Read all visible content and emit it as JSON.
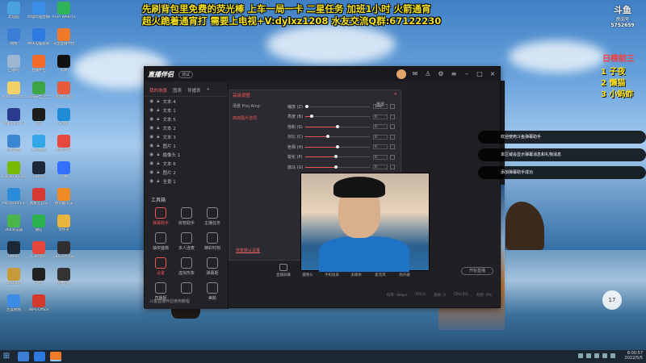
{
  "overlay": {
    "line1": "先刷背包里免费的荧光棒    上车一局一卡      二星任务 加班1小时    火箭通宵",
    "line2": "超火跪着通宵打  需要上电视+V:dylxz1208   水友交流Q群:67122230"
  },
  "desktop_icons": [
    {
      "label": "此电脑",
      "color": "#4aa3df"
    },
    {
      "label": "哔哩哔哩直播姬",
      "color": "#3a8ee6"
    },
    {
      "label": "Iriun Webcam",
      "color": "#2fb45a"
    },
    {
      "label": "网络",
      "color": "#3a7fd5"
    },
    {
      "label": "腾讯电脑管家",
      "color": "#2d7be0"
    },
    {
      "label": "斗鱼直播伴侣",
      "color": "#f07a2a"
    },
    {
      "label": "回收站",
      "color": "#9cb7d2"
    },
    {
      "label": "直播伴侣",
      "color": "#f26b2a"
    },
    {
      "label": "剪映",
      "color": "#111"
    },
    {
      "label": "Administrator",
      "color": "#f3d166"
    },
    {
      "label": "360安全卫士",
      "color": "#3ea544"
    },
    {
      "label": "游戏加速器",
      "color": "#e85a3c"
    },
    {
      "label": "Wallpaper Engine",
      "color": "#2a3a8f"
    },
    {
      "label": "QQ",
      "color": "#1d1d1d"
    },
    {
      "label": "Edge",
      "color": "#1f8ad6"
    },
    {
      "label": "控制面板",
      "color": "#3b86d1"
    },
    {
      "label": "腾讯视频",
      "color": "#33a6ea"
    },
    {
      "label": "酷狗音乐",
      "color": "#e8473b"
    },
    {
      "label": "GeForce Experience",
      "color": "#76b900"
    },
    {
      "label": "Steam",
      "color": "#1b2838"
    },
    {
      "label": "飞书",
      "color": "#3370ff"
    },
    {
      "label": "Microsoft Edge",
      "color": "#2b8bd8"
    },
    {
      "label": "网易云音乐",
      "color": "#d63a32"
    },
    {
      "label": "搜狗输入法",
      "color": "#f08a24"
    },
    {
      "label": "360浏览器",
      "color": "#49b54b"
    },
    {
      "label": "微信",
      "color": "#2bb24c"
    },
    {
      "label": "文件夹",
      "color": "#e8b63c"
    },
    {
      "label": "Steam",
      "color": "#1b2838"
    },
    {
      "label": "Chrome",
      "color": "#e4463a"
    },
    {
      "label": "OBS Studio",
      "color": "#302e31"
    },
    {
      "label": "WeGame",
      "color": "#c79a3a"
    },
    {
      "label": "斗鱼",
      "color": "#222"
    },
    {
      "label": "快捷方式",
      "color": "#333"
    },
    {
      "label": "百度网盘",
      "color": "#3c8ce6"
    },
    {
      "label": "WPS Office",
      "color": "#d33a2c"
    }
  ],
  "app": {
    "title": "直播伴侣",
    "version": "测试",
    "tabs": [
      "我的场景",
      "图表",
      "导播表",
      "+"
    ],
    "sources": [
      "文本 4",
      "文本 1",
      "文本 5",
      "文本 2",
      "文本 3",
      "图片 1",
      "摄像头 1",
      "文本 6",
      "图片 2",
      "全景 1"
    ],
    "toolbox_title": "工具箱",
    "tools": [
      {
        "label": "弹幕助手",
        "red": true
      },
      {
        "label": "房管助手",
        "red": false
      },
      {
        "label": "主播任务",
        "red": false
      },
      {
        "label": "抽奖盛典",
        "red": false
      },
      {
        "label": "多人连麦",
        "red": false
      },
      {
        "label": "精彩时刻",
        "red": false
      },
      {
        "label": "设置",
        "red": true
      },
      {
        "label": "虚拟形象",
        "red": false
      },
      {
        "label": "弹幕姬",
        "red": false
      },
      {
        "label": "直播姬",
        "red": false
      },
      {
        "label": "",
        "red": false
      },
      {
        "label": "美颜",
        "red": false
      }
    ],
    "footer": "斗鱼直播伴侣使用教程",
    "dialog": {
      "title": "高级调整",
      "close": "×",
      "left_items": [
        "场景 Proj Amp",
        "高级图片选项"
      ],
      "reset": "重置",
      "sliders": [
        {
          "label": "缩放 (Z)",
          "value": "100",
          "level": 0.02
        },
        {
          "label": "亮度 (B)",
          "value": "0",
          "level": 0.1
        },
        {
          "label": "饱和 (S)",
          "value": "0",
          "level": 0.5
        },
        {
          "label": "对比 (C)",
          "value": "0",
          "level": 0.35
        },
        {
          "label": "色相 (H)",
          "value": "0",
          "level": 0.5
        },
        {
          "label": "锐化 (P)",
          "value": "0",
          "level": 0.48
        },
        {
          "label": "伽马 (G)",
          "value": "0",
          "level": 0.48
        }
      ],
      "link": "恢复默认设置"
    },
    "bottom_tools": [
      "直播屏幕",
      "摄像头",
      "手机投屏",
      "多媒体",
      "麦克风",
      "扬声器"
    ],
    "live_button": "开始直播",
    "status": [
      "码率: 0kbps",
      "FPS:0",
      "丢帧: 0",
      "CPU:0%",
      "内存: 0%"
    ]
  },
  "preview": {
    "toolbar_icons": [
      "share-icon",
      "crop-icon",
      "rotate-icon"
    ]
  },
  "douyu": {
    "logo": "斗鱼",
    "sub": "房间号",
    "room": "5752659"
  },
  "rank": {
    "title": "日榜前三",
    "items": [
      "1  子夜",
      "2  懒猫",
      "3  小蚂蚱"
    ]
  },
  "chat": [
    "欢迎使用斗鱼弹幕助手",
    "本区域会显示弹幕消息和礼物消息",
    "添加弹幕助手成功"
  ],
  "chat_count": "17",
  "taskbar": {
    "time": "8:00:57",
    "date": "2022/5/5"
  }
}
